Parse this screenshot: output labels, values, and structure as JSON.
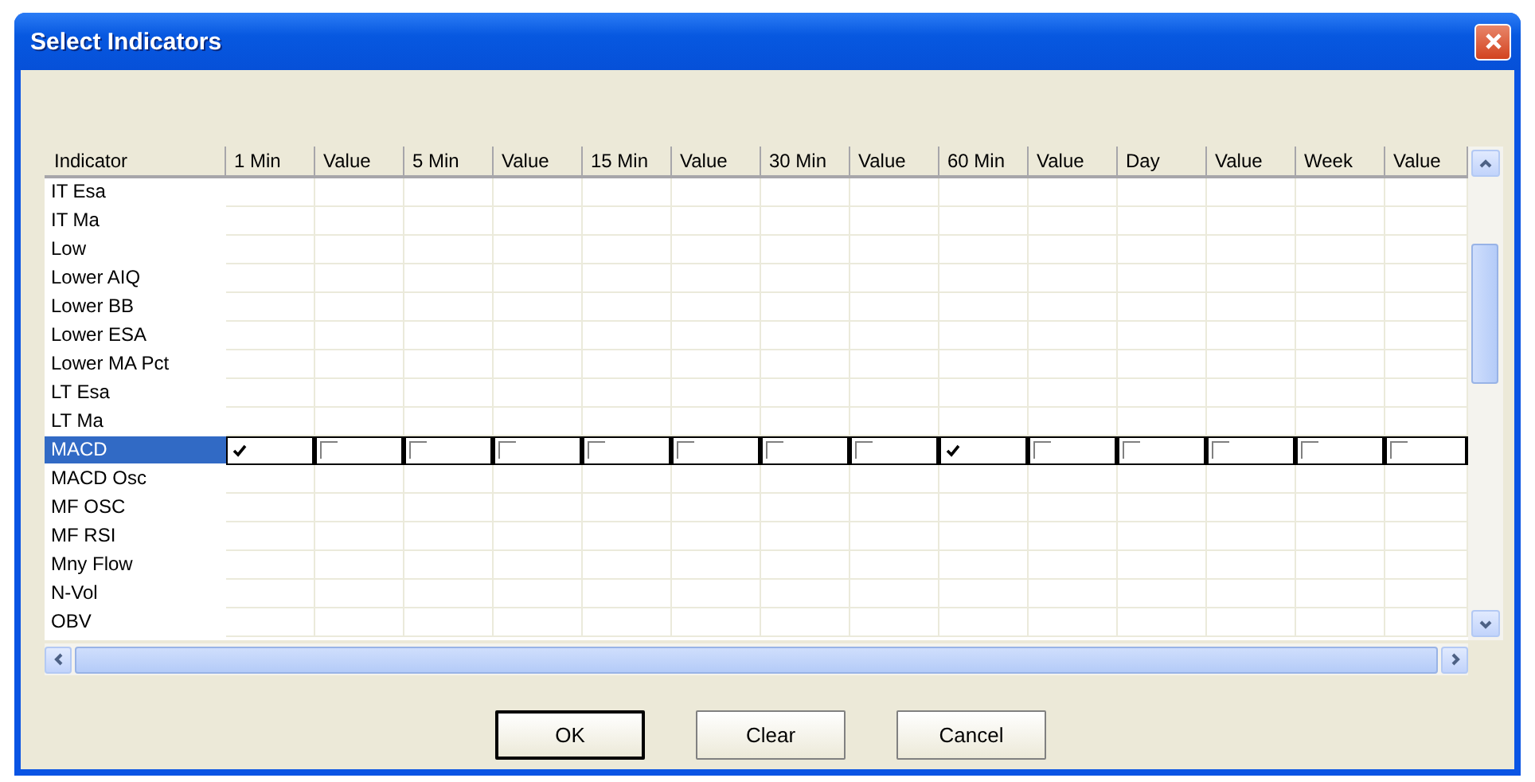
{
  "window": {
    "title": "Select Indicators"
  },
  "table": {
    "columns": [
      "Indicator",
      "1 Min",
      "Value",
      "5 Min",
      "Value",
      "15 Min",
      "Value",
      "30 Min",
      "Value",
      "60 Min",
      "Value",
      "Day",
      "Value",
      "Week",
      "Value"
    ],
    "rows": [
      {
        "name": "IT Esa",
        "selected": false
      },
      {
        "name": "IT Ma",
        "selected": false
      },
      {
        "name": "Low",
        "selected": false
      },
      {
        "name": "Lower AIQ",
        "selected": false
      },
      {
        "name": "Lower BB",
        "selected": false
      },
      {
        "name": "Lower ESA",
        "selected": false
      },
      {
        "name": "Lower MA Pct",
        "selected": false
      },
      {
        "name": "LT Esa",
        "selected": false
      },
      {
        "name": "LT Ma",
        "selected": false
      },
      {
        "name": "MACD",
        "selected": true,
        "checks": [
          true,
          false,
          false,
          false,
          false,
          false,
          false,
          false,
          true,
          false,
          false,
          false,
          false,
          false
        ]
      },
      {
        "name": "MACD Osc",
        "selected": false
      },
      {
        "name": "MF OSC",
        "selected": false
      },
      {
        "name": "MF RSI",
        "selected": false
      },
      {
        "name": "Mny Flow",
        "selected": false
      },
      {
        "name": "N-Vol",
        "selected": false
      },
      {
        "name": "OBV",
        "selected": false
      }
    ]
  },
  "buttons": [
    {
      "label": "OK",
      "default": true
    },
    {
      "label": "Clear",
      "default": false
    },
    {
      "label": "Cancel",
      "default": false
    }
  ]
}
